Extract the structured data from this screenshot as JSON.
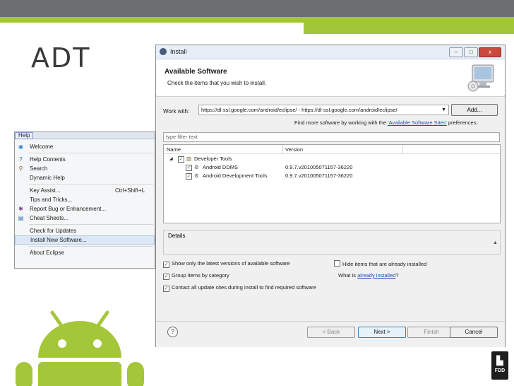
{
  "slide_title": "ADT",
  "help_menu": {
    "menubar_label": "Help",
    "items": [
      {
        "label": "Welcome",
        "icon": "welcome-icon"
      },
      {
        "label": "Help Contents",
        "icon": "help-icon"
      },
      {
        "label": "Search",
        "icon": "search-icon"
      },
      {
        "label": "Dynamic Help",
        "icon": ""
      },
      {
        "label": "Key Assist...",
        "shortcut": "Ctrl+Shift+L"
      },
      {
        "label": "Tips and Tricks..."
      },
      {
        "label": "Report Bug or Enhancement...",
        "icon": "bug-icon"
      },
      {
        "label": "Cheat Sheets...",
        "icon": "cheat-sheet-icon"
      },
      {
        "label": "Check for Updates"
      },
      {
        "label": "Install New Software..."
      },
      {
        "label": "About Eclipse"
      }
    ]
  },
  "dialog": {
    "title": "Install",
    "heading": "Available Software",
    "subheading": "Check the items that you wish to install.",
    "work_with_label": "Work with:",
    "work_with_value": "https://dl-ssl.google.com/android/eclipse/ - https://dl-ssl.google.com/android/eclipse/",
    "add_button": "Add...",
    "find_more_prefix": "Find more software by working with the",
    "find_more_link": "'Available Software Sites'",
    "find_more_suffix": "preferences.",
    "filter_placeholder": "type filter text",
    "columns": {
      "name": "Name",
      "version": "Version"
    },
    "tree": {
      "group": "Developer Tools",
      "items": [
        {
          "name": "Android DDMS",
          "version": "0.9.7.v201005071157-36220"
        },
        {
          "name": "Android Development Tools",
          "version": "0.9.7.v201005071157-36220"
        }
      ]
    },
    "details_label": "Details",
    "options": {
      "show_latest": "Show only the latest versions of available software",
      "hide_installed": "Hide items that are already installed",
      "group_by_category": "Group items by category",
      "what_is_prefix": "What is",
      "what_is_link": "already installed",
      "what_is_suffix": "?",
      "contact_sites": "Contact all update sites during install to find required software"
    },
    "buttons": {
      "back": "< Back",
      "next": "Next >",
      "finish": "Finish",
      "cancel": "Cancel"
    },
    "window_buttons": {
      "minimize": "–",
      "maximize": "□",
      "close": "x"
    }
  },
  "logo_text": "FDD",
  "colors": {
    "accent_green": "#a3c639",
    "top_bar_gray": "#6d6e71",
    "android_green": "#a4c639"
  }
}
